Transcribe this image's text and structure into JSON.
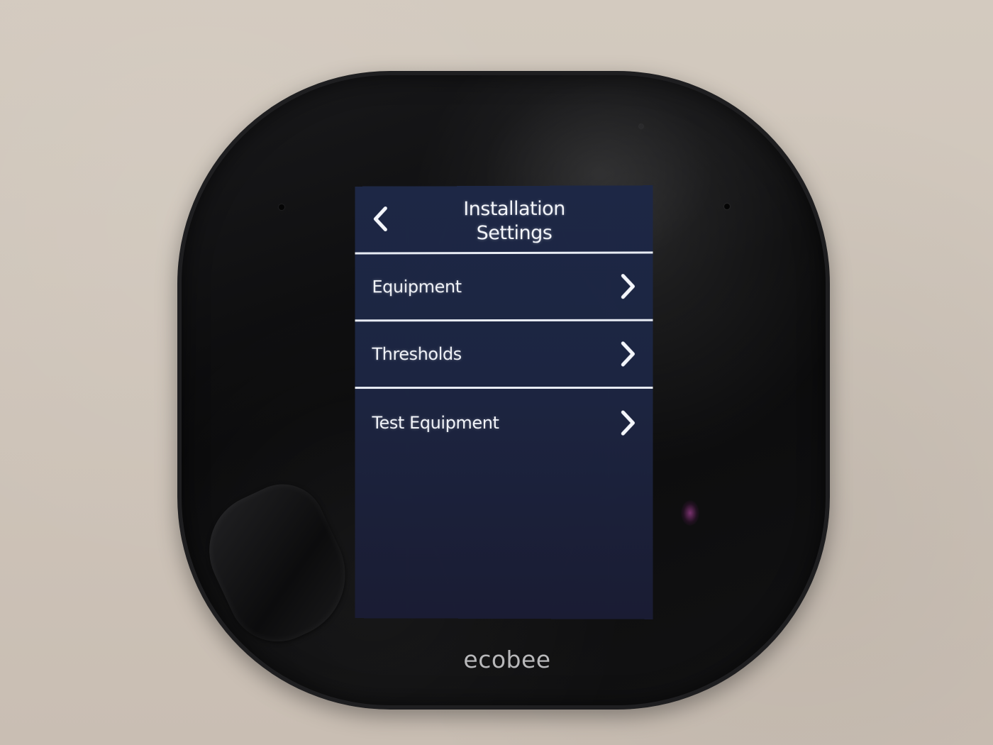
{
  "screen": {
    "title_line1": "Installation",
    "title_line2": "Settings",
    "back_icon": "chevron-left-icon",
    "menu": [
      {
        "label": "Equipment",
        "icon": "chevron-right-icon"
      },
      {
        "label": "Thresholds",
        "icon": "chevron-right-icon"
      },
      {
        "label": "Test Equipment",
        "icon": "chevron-right-icon"
      }
    ]
  },
  "device": {
    "brand": "ecobee"
  },
  "colors": {
    "screen_bg": "#1c2541",
    "text": "#f4f6fb",
    "divider": "#e8ecf4",
    "bezel": "#0a0a0b",
    "wall": "#cfc5bb",
    "brand_text": "#b8b8ba"
  }
}
